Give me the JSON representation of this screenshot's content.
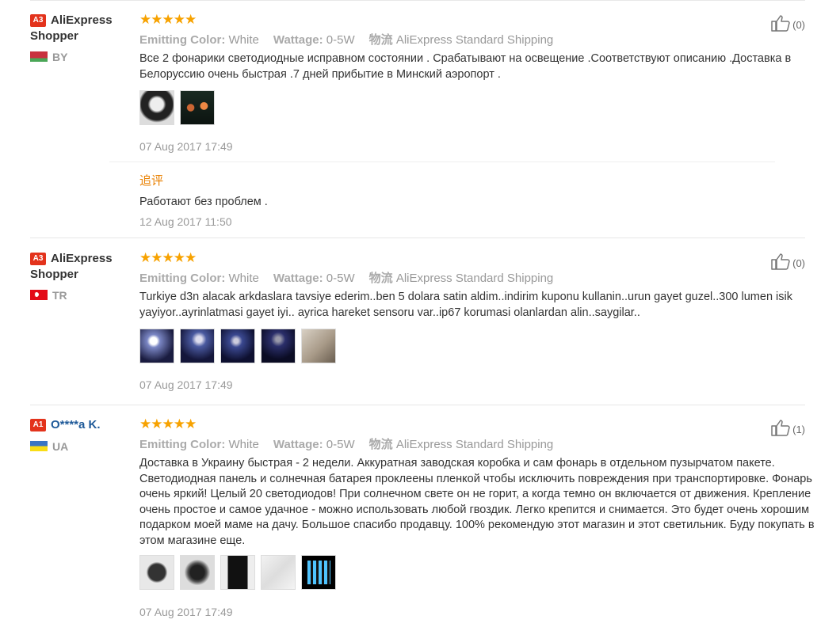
{
  "reviews": [
    {
      "level": "A3",
      "name": "AliExpress Shopper",
      "country": "BY",
      "stars": "★★★★★",
      "attr1_label": "Emitting Color:",
      "attr1_value": "White",
      "attr2_label": "Wattage:",
      "attr2_value": "0-5W",
      "shipping_label": "物流",
      "shipping_value": "AliExpress Standard Shipping",
      "helpful": "(0)",
      "text": "Все 2 фонарики светодиодные исправном состоянии . Срабатывают на освещение .Соответствуют описанию .Доставка в Белоруссию очень быстрая .7 дней прибытие в Минский аэропорт .",
      "date": "07 Aug 2017 17:49",
      "followup_title": "追评",
      "followup_text": "Работают без проблем .",
      "followup_date": "12 Aug 2017 11:50"
    },
    {
      "level": "A3",
      "name": "AliExpress Shopper",
      "country": "TR",
      "stars": "★★★★★",
      "attr1_label": "Emitting Color:",
      "attr1_value": "White",
      "attr2_label": "Wattage:",
      "attr2_value": "0-5W",
      "shipping_label": "物流",
      "shipping_value": "AliExpress Standard Shipping",
      "helpful": "(0)",
      "text": "Turkiye d3n alacak arkdaslara tavsiye ederim..ben 5 dolara satin aldim..indirim kuponu kullanin..urun gayet guzel..300 lumen isik yayiyor..ayrinlatmasi gayet iyi.. ayrica hareket sensoru var..ip67 korumasi olanlardan alin..saygilar..",
      "date": "07 Aug 2017 17:49"
    },
    {
      "level": "A1",
      "name": "O****a K.",
      "country": "UA",
      "stars": "★★★★★",
      "attr1_label": "Emitting Color:",
      "attr1_value": "White",
      "attr2_label": "Wattage:",
      "attr2_value": "0-5W",
      "shipping_label": "物流",
      "shipping_value": "AliExpress Standard Shipping",
      "helpful": "(1)",
      "text": "Доставка в Украину быстрая - 2 недели. Аккуратная заводская коробка и сам фонарь в отдельном пузырчатом пакете. Светодиодная панель и солнечная батарея проклеены пленкой чтобы исключить повреждения при транспортировке. Фонарь очень яркий! Целый 20 светодиодов! При солнечном свете он не горит, а когда темно он включается от движения. Крепление очень простое и самое удачное - можно использовать любой гвоздик. Легко крепится и снимается. Это будет очень хорошим подарком моей маме на дачу. Большое спасибо продавцу. 100% рекомендую этот магазин и этот светильник. Буду покупать в этом магазине еще.",
      "date": "07 Aug 2017 17:49"
    }
  ]
}
